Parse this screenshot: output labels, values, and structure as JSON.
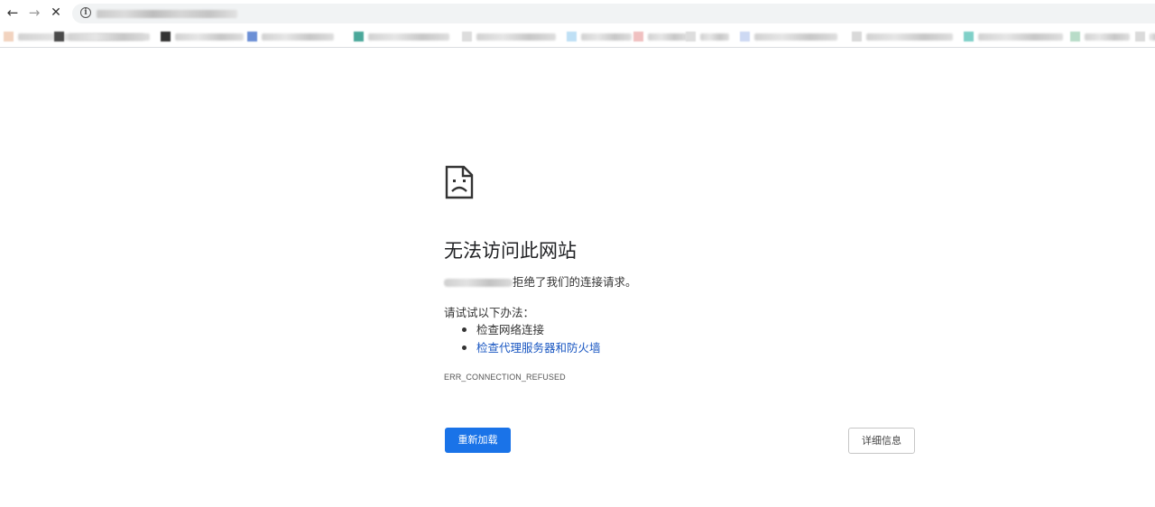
{
  "browser": {
    "nav": {
      "back_icon": "←",
      "forward_icon": "→",
      "stop_icon": "✕"
    },
    "omnibox": {
      "info_icon": "i"
    },
    "bookmarks": [
      {
        "favicon_color": "#f2d3bf"
      },
      {
        "favicon_color": "#4a4a4a"
      },
      {
        "favicon_color": "#333333"
      },
      {
        "favicon_color": "#6b8fd6"
      },
      {
        "favicon_color": "#4aa89a"
      },
      {
        "favicon_color": "#dddddd"
      },
      {
        "favicon_color": "#bfe0f5"
      },
      {
        "favicon_color": "#f0c0c0"
      },
      {
        "favicon_color": "#dddddd"
      },
      {
        "favicon_color": "#cdd9f3"
      },
      {
        "favicon_color": "#d9d9d9"
      },
      {
        "favicon_color": "#7fd0c8"
      },
      {
        "favicon_color": "#b8dcc8"
      },
      {
        "favicon_color": "#dadada"
      }
    ]
  },
  "error_page": {
    "icon": "sad-page-icon",
    "title": "无法访问此网站",
    "host_message": "拒绝了我们的连接请求。",
    "suggestions_heading": "请试试以下办法：",
    "suggestions": [
      {
        "label": "检查网络连接",
        "is_link": false
      },
      {
        "label": "检查代理服务器和防火墙",
        "is_link": true
      }
    ],
    "error_code": "ERR_CONNECTION_REFUSED",
    "reload_button": "重新加载",
    "details_button": "详细信息",
    "colors": {
      "primary_button": "#1a73e8",
      "link": "#1a57c2"
    }
  }
}
